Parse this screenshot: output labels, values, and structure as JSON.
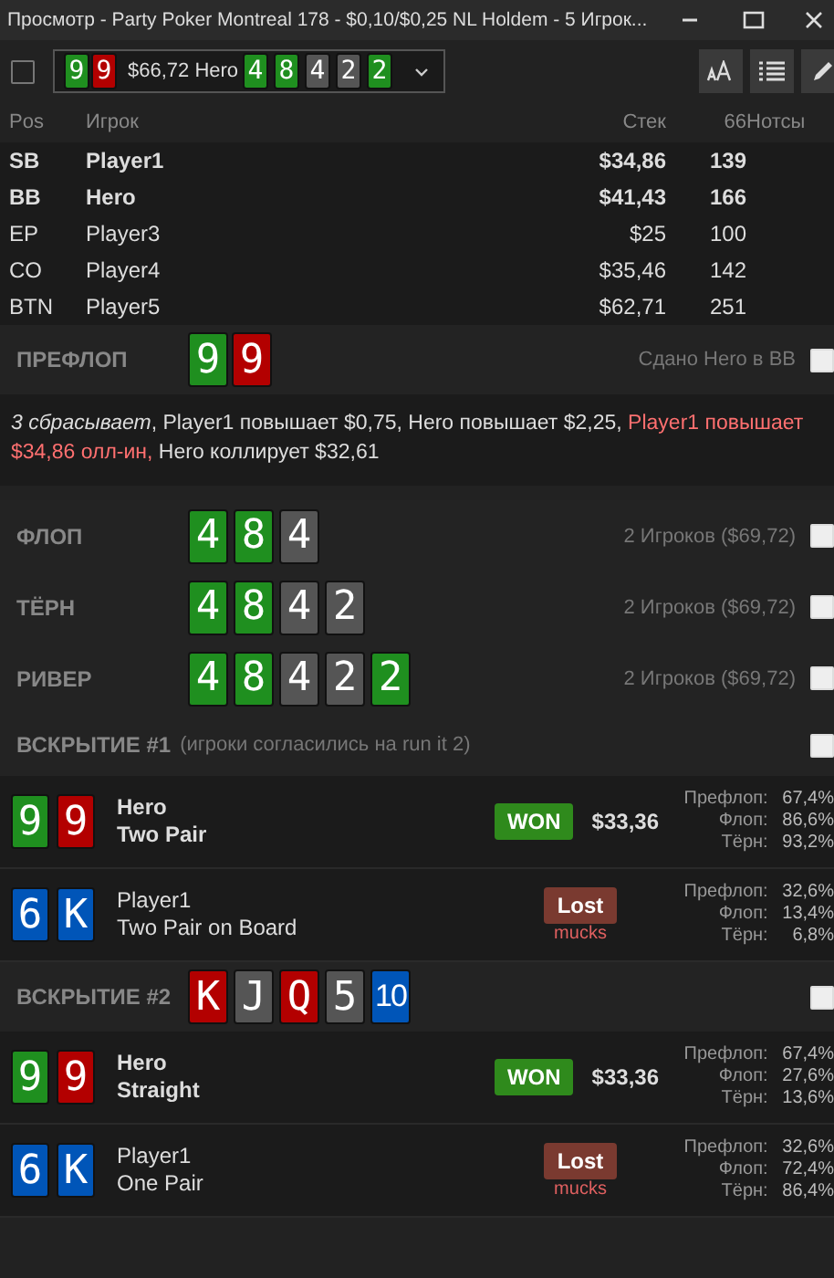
{
  "window": {
    "title": "Просмотр - Party Poker Montreal 178 - $0,10/$0,25 NL Holdem - 5 Игрок..."
  },
  "toolbar": {
    "checked": false,
    "hand": {
      "hole_cards": [
        {
          "rank": "9",
          "color": "#1f8f1f"
        },
        {
          "rank": "9",
          "color": "#b30000"
        }
      ],
      "summary": "$66,72 Hero",
      "board": [
        {
          "rank": "4",
          "color": "#1f8f1f"
        },
        {
          "rank": "8",
          "color": "#1f8f1f"
        },
        {
          "rank": "4",
          "color": "#555555"
        },
        {
          "rank": "2",
          "color": "#555555"
        },
        {
          "rank": "2",
          "color": "#1f8f1f"
        }
      ]
    }
  },
  "table": {
    "columns": [
      "Pos",
      "Игрок",
      "Стек",
      "66",
      "Нотсы"
    ],
    "rows": [
      {
        "pos": "SB",
        "player": "Player1",
        "stack": "$34,86",
        "hands": "139",
        "in_hand": true
      },
      {
        "pos": "BB",
        "player": "Hero",
        "stack": "$41,43",
        "hands": "166",
        "in_hand": true
      },
      {
        "pos": "EP",
        "player": "Player3",
        "stack": "$25",
        "hands": "100",
        "in_hand": false
      },
      {
        "pos": "CO",
        "player": "Player4",
        "stack": "$35,46",
        "hands": "142",
        "in_hand": false
      },
      {
        "pos": "BTN",
        "player": "Player5",
        "stack": "$62,71",
        "hands": "251",
        "in_hand": false
      }
    ]
  },
  "preflop": {
    "label": "ПРЕФЛОП",
    "cards": [
      {
        "rank": "9",
        "color": "#1f8f1f"
      },
      {
        "rank": "9",
        "color": "#b30000"
      }
    ],
    "info": "Сдано Hero в BB",
    "checked": false,
    "actions": [
      {
        "kind": "fold",
        "text": "3 сбрасывает"
      },
      {
        "kind": "plain",
        "text": ", Player1 повышает $0,75, Hero повышает $2,25, "
      },
      {
        "kind": "allin",
        "text": "Player1 повышает $34,86 олл-ин,"
      },
      {
        "kind": "plain",
        "text": " Hero коллирует $32,61"
      }
    ]
  },
  "streets": [
    {
      "label": "ФЛОП",
      "cards": [
        {
          "rank": "4",
          "color": "#1f8f1f"
        },
        {
          "rank": "8",
          "color": "#1f8f1f"
        },
        {
          "rank": "4",
          "color": "#555555"
        }
      ],
      "info": "2 Игроков ($69,72)",
      "checked": false
    },
    {
      "label": "ТЁРН",
      "cards": [
        {
          "rank": "4",
          "color": "#1f8f1f"
        },
        {
          "rank": "8",
          "color": "#1f8f1f"
        },
        {
          "rank": "4",
          "color": "#555555"
        },
        {
          "rank": "2",
          "color": "#555555"
        }
      ],
      "info": "2 Игроков ($69,72)",
      "checked": false
    },
    {
      "label": "РИВЕР",
      "cards": [
        {
          "rank": "4",
          "color": "#1f8f1f"
        },
        {
          "rank": "8",
          "color": "#1f8f1f"
        },
        {
          "rank": "4",
          "color": "#555555"
        },
        {
          "rank": "2",
          "color": "#555555"
        },
        {
          "rank": "2",
          "color": "#1f8f1f"
        }
      ],
      "info": "2 Игроков ($69,72)",
      "checked": false
    }
  ],
  "showdowns": [
    {
      "label": "ВСКРЫТИЕ #1",
      "note": "(игроки согласились на run it 2)",
      "checked": false,
      "players": [
        {
          "cards": [
            {
              "rank": "9",
              "color": "#1f8f1f"
            },
            {
              "rank": "9",
              "color": "#b30000"
            }
          ],
          "name": "Hero",
          "hand": "Two Pair",
          "won": true,
          "badge": "WON",
          "amount": "$33,36",
          "stats": [
            [
              "Префлоп:",
              "67,4%"
            ],
            [
              "Флоп:",
              "86,6%"
            ],
            [
              "Тёрн:",
              "93,2%"
            ]
          ]
        },
        {
          "cards": [
            {
              "rank": "6",
              "color": "#0055b8"
            },
            {
              "rank": "K",
              "color": "#0055b8"
            }
          ],
          "name": "Player1",
          "hand": "Two Pair on Board",
          "won": false,
          "badge": "Lost",
          "sub": "mucks",
          "stats": [
            [
              "Префлоп:",
              "32,6%"
            ],
            [
              "Флоп:",
              "13,4%"
            ],
            [
              "Тёрн:",
              "6,8%"
            ]
          ]
        }
      ]
    },
    {
      "label": "ВСКРЫТИЕ #2",
      "checked": false,
      "board": [
        {
          "rank": "K",
          "color": "#b30000"
        },
        {
          "rank": "J",
          "color": "#555555"
        },
        {
          "rank": "Q",
          "color": "#b30000"
        },
        {
          "rank": "5",
          "color": "#555555"
        },
        {
          "rank": "10",
          "color": "#0055b8"
        }
      ],
      "players": [
        {
          "cards": [
            {
              "rank": "9",
              "color": "#1f8f1f"
            },
            {
              "rank": "9",
              "color": "#b30000"
            }
          ],
          "name": "Hero",
          "hand": "Straight",
          "won": true,
          "badge": "WON",
          "amount": "$33,36",
          "stats": [
            [
              "Префлоп:",
              "67,4%"
            ],
            [
              "Флоп:",
              "27,6%"
            ],
            [
              "Тёрн:",
              "13,6%"
            ]
          ]
        },
        {
          "cards": [
            {
              "rank": "6",
              "color": "#0055b8"
            },
            {
              "rank": "K",
              "color": "#0055b8"
            }
          ],
          "name": "Player1",
          "hand": "One Pair",
          "won": false,
          "badge": "Lost",
          "sub": "mucks",
          "stats": [
            [
              "Префлоп:",
              "32,6%"
            ],
            [
              "Флоп:",
              "72,4%"
            ],
            [
              "Тёрн:",
              "86,4%"
            ]
          ]
        }
      ]
    }
  ]
}
